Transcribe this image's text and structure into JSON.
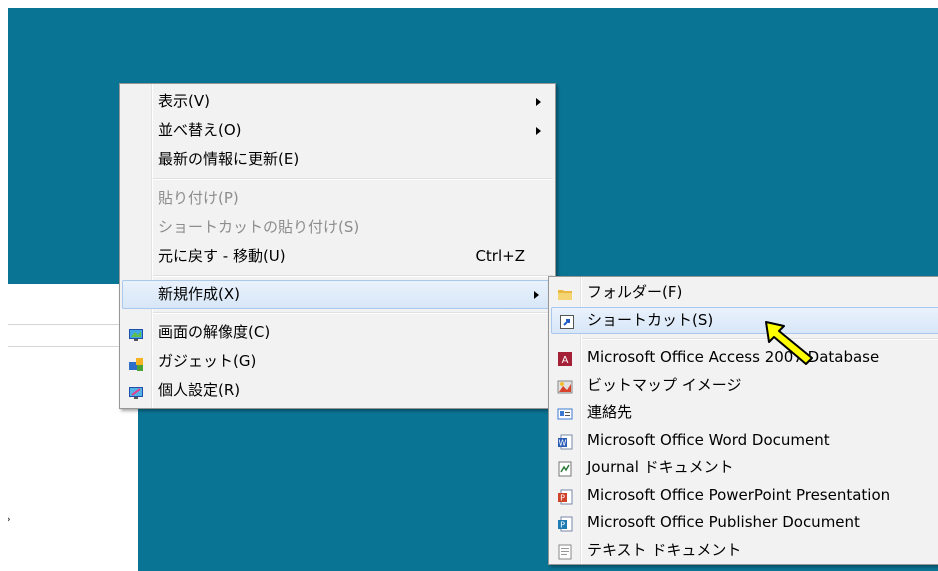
{
  "context_menu": {
    "items": [
      {
        "label": "表示(V)"
      },
      {
        "label": "並べ替え(O)"
      },
      {
        "label": "最新の情報に更新(E)"
      },
      {
        "label": "貼り付け(P)"
      },
      {
        "label": "ショートカットの貼り付け(S)"
      },
      {
        "label": "元に戻す - 移動(U)",
        "shortcut": "Ctrl+Z"
      },
      {
        "label": "新規作成(X)"
      },
      {
        "label": "画面の解像度(C)"
      },
      {
        "label": "ガジェット(G)"
      },
      {
        "label": "個人設定(R)"
      }
    ]
  },
  "new_submenu": {
    "items": [
      {
        "label": "フォルダー(F)",
        "icon": "folder-icon"
      },
      {
        "label": "ショートカット(S)",
        "icon": "shortcut-icon"
      },
      {
        "label": "Microsoft Office Access 2007 Database",
        "icon": "access-icon"
      },
      {
        "label": "ビットマップ イメージ",
        "icon": "bitmap-icon"
      },
      {
        "label": "連絡先",
        "icon": "contact-icon"
      },
      {
        "label": "Microsoft Office Word Document",
        "icon": "word-icon"
      },
      {
        "label": "Journal ドキュメント",
        "icon": "journal-icon"
      },
      {
        "label": "Microsoft Office PowerPoint Presentation",
        "icon": "powerpoint-icon"
      },
      {
        "label": "Microsoft Office Publisher Document",
        "icon": "publisher-icon"
      },
      {
        "label": "テキスト ドキュメント",
        "icon": "text-document-icon"
      }
    ]
  },
  "colors": {
    "desktop": "#0a7494",
    "menu_bg": "#f2f2f2",
    "highlight": "#d7e6f7",
    "cursor": "#ffff00"
  }
}
